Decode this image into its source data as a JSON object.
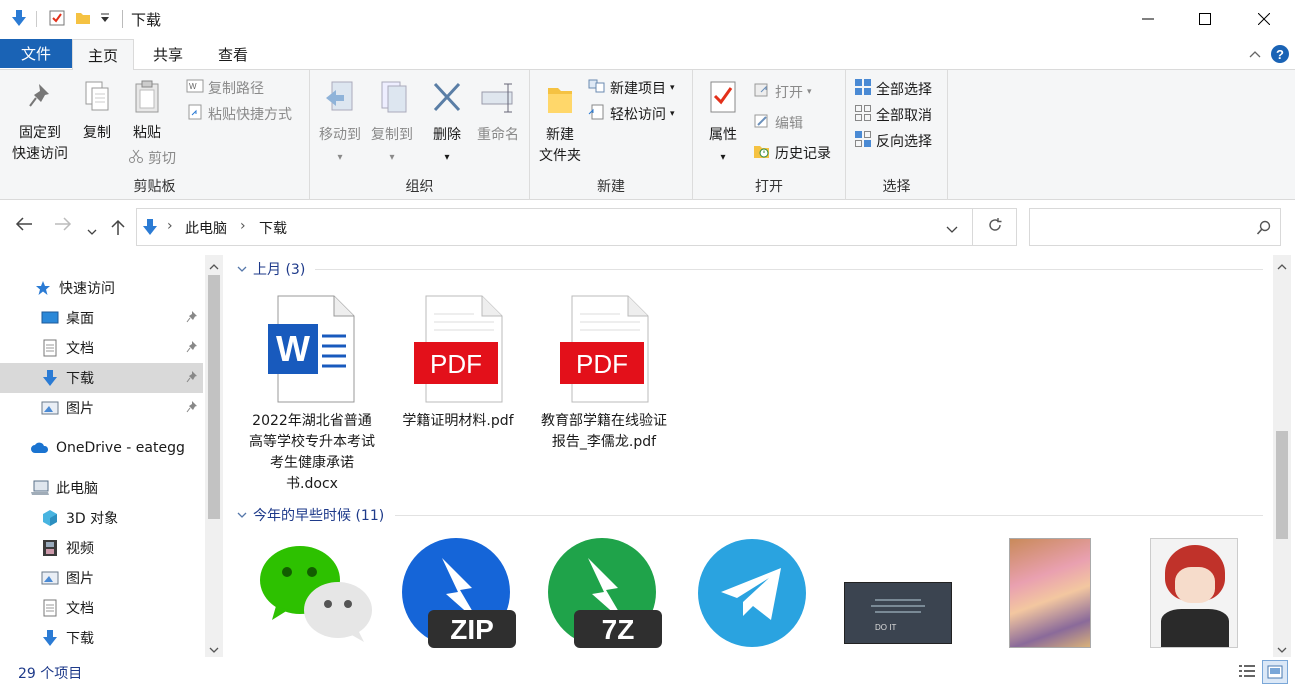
{
  "window": {
    "title": "下载",
    "controls": [
      "minimize",
      "maximize",
      "close"
    ]
  },
  "ribbon_tabs": {
    "file": "文件",
    "home": "主页",
    "share": "共享",
    "view": "查看"
  },
  "ribbon": {
    "clipboard": {
      "label": "剪贴板",
      "pin_line1": "固定到",
      "pin_line2": "快速访问",
      "copy": "复制",
      "paste": "粘贴",
      "copy_path": "复制路径",
      "paste_shortcut": "粘贴快捷方式",
      "cut": "剪切"
    },
    "organize": {
      "label": "组织",
      "move_to": "移动到",
      "copy_to": "复制到",
      "delete": "删除",
      "rename": "重命名"
    },
    "new": {
      "label": "新建",
      "new_folder_line1": "新建",
      "new_folder_line2": "文件夹",
      "new_item": "新建项目",
      "easy_access": "轻松访问"
    },
    "open": {
      "label": "打开",
      "properties": "属性",
      "open": "打开",
      "edit": "编辑",
      "history": "历史记录"
    },
    "select": {
      "label": "选择",
      "select_all": "全部选择",
      "select_none": "全部取消",
      "invert": "反向选择"
    }
  },
  "address": {
    "crumbs": [
      "此电脑",
      "下载"
    ],
    "search_placeholder": ""
  },
  "nav_pane": {
    "quick_access": "快速访问",
    "items": [
      {
        "label": "桌面",
        "pinned": true
      },
      {
        "label": "文档",
        "pinned": true
      },
      {
        "label": "下载",
        "pinned": true,
        "selected": true
      },
      {
        "label": "图片",
        "pinned": true
      }
    ],
    "onedrive": "OneDrive - eategg",
    "this_pc": "此电脑",
    "pc_items": [
      "3D 对象",
      "视频",
      "图片",
      "文档",
      "下载"
    ]
  },
  "content": {
    "groups": [
      {
        "header": "上月 (3)",
        "files": [
          {
            "name": "2022年湖北省普通高等学校专升本考试考生健康承诺书.docx",
            "type": "docx"
          },
          {
            "name": "学籍证明材料.pdf",
            "type": "pdf"
          },
          {
            "name": "教育部学籍在线验证报告_李儒龙.pdf",
            "type": "pdf"
          }
        ]
      },
      {
        "header": "今年的早些时候 (11)",
        "files": [
          {
            "type": "wechat-icon"
          },
          {
            "type": "zip-icon",
            "badge": "ZIP"
          },
          {
            "type": "7z-icon",
            "badge": "7Z"
          },
          {
            "type": "telegram-icon"
          },
          {
            "type": "screenshot-thumbnail",
            "text": "DO IT"
          },
          {
            "type": "anime-image-thumbnail"
          },
          {
            "type": "anime-avatar-thumbnail"
          }
        ]
      }
    ],
    "pdf_badge": "PDF",
    "word_badge": "W"
  },
  "status": {
    "item_count": "29 个项目"
  },
  "colors": {
    "accent": "#1a63b5",
    "pdf_red": "#e3101a",
    "word_blue": "#185abd",
    "group_header": "#1e3a8a"
  }
}
